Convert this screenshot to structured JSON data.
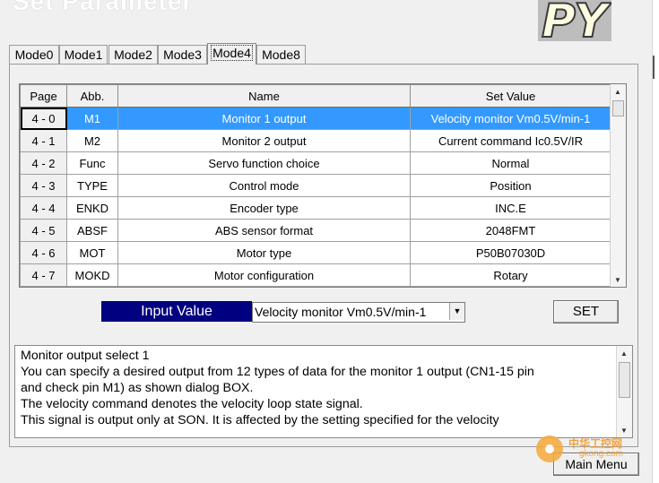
{
  "window": {
    "title": "Set Parameter"
  },
  "tabs": [
    "Mode0",
    "Mode1",
    "Mode2",
    "Mode3",
    "Mode4",
    "Mode8"
  ],
  "active_tab": "Mode4",
  "table": {
    "headers": [
      "Page",
      "Abb.",
      "Name",
      "Set Value"
    ],
    "rows": [
      {
        "page": "4 - 0",
        "abb": "M1",
        "name": "Monitor 1 output",
        "value": "Velocity monitor Vm0.5V/min-1"
      },
      {
        "page": "4 - 1",
        "abb": "M2",
        "name": "Monitor 2 output",
        "value": "Current command  Ic0.5V/IR"
      },
      {
        "page": "4 - 2",
        "abb": "Func",
        "name": "Servo function choice",
        "value": "Normal"
      },
      {
        "page": "4 - 3",
        "abb": "TYPE",
        "name": "Control mode",
        "value": "Position"
      },
      {
        "page": "4 - 4",
        "abb": "ENKD",
        "name": "Encoder type",
        "value": "INC.E"
      },
      {
        "page": "4 - 5",
        "abb": "ABSF",
        "name": "ABS sensor format",
        "value": "2048FMT"
      },
      {
        "page": "4 - 6",
        "abb": "MOT",
        "name": "Motor type",
        "value": "P50B07030D"
      },
      {
        "page": "4 - 7",
        "abb": "MOKD",
        "name": "Motor configuration",
        "value": "Rotary"
      }
    ],
    "selected_row": 0
  },
  "input": {
    "label": "Input Value",
    "selected": "Velocity monitor Vm0.5V/min-1"
  },
  "set_button": "SET",
  "description": [
    "Monitor output select 1",
    "You can specify a desired output from 12 types of data for the monitor 1 output (CN1-15 pin",
    "and check pin M1) as shown dialog BOX.",
    "The velocity command denotes the velocity loop state signal.",
    "This signal is output only at SON. It is affected by the setting specified for the velocity"
  ],
  "main_menu_button": "Main Menu",
  "watermark": {
    "cn": "中华工控网",
    "url": "gkong.com"
  },
  "colors": {
    "selection": "#3399ff",
    "input_label_bg": "#000080"
  }
}
